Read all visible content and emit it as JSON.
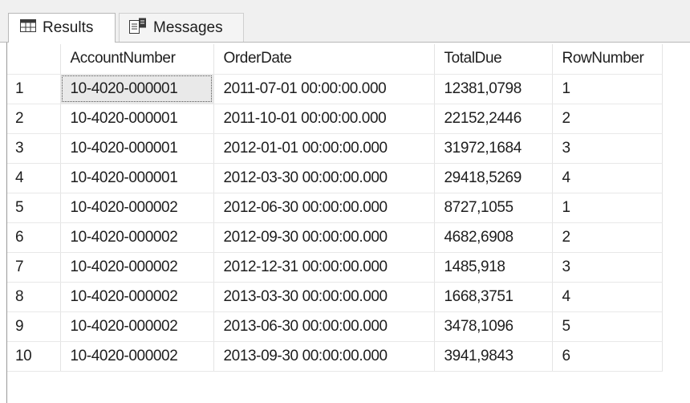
{
  "tabs": {
    "results_label": "Results",
    "messages_label": "Messages",
    "results_icon": "grid-icon",
    "messages_icon": "messages-icon"
  },
  "grid": {
    "columns": [
      "",
      "AccountNumber",
      "OrderDate",
      "TotalDue",
      "RowNumber"
    ],
    "rows": [
      [
        "1",
        "10-4020-000001",
        "2011-07-01 00:00:00.000",
        "12381,0798",
        "1"
      ],
      [
        "2",
        "10-4020-000001",
        "2011-10-01 00:00:00.000",
        "22152,2446",
        "2"
      ],
      [
        "3",
        "10-4020-000001",
        "2012-01-01 00:00:00.000",
        "31972,1684",
        "3"
      ],
      [
        "4",
        "10-4020-000001",
        "2012-03-30 00:00:00.000",
        "29418,5269",
        "4"
      ],
      [
        "5",
        "10-4020-000002",
        "2012-06-30 00:00:00.000",
        "8727,1055",
        "1"
      ],
      [
        "6",
        "10-4020-000002",
        "2012-09-30 00:00:00.000",
        "4682,6908",
        "2"
      ],
      [
        "7",
        "10-4020-000002",
        "2012-12-31 00:00:00.000",
        "1485,918",
        "3"
      ],
      [
        "8",
        "10-4020-000002",
        "2013-03-30 00:00:00.000",
        "1668,3751",
        "4"
      ],
      [
        "9",
        "10-4020-000002",
        "2013-06-30 00:00:00.000",
        "3478,1096",
        "5"
      ],
      [
        "10",
        "10-4020-000002",
        "2013-09-30 00:00:00.000",
        "3941,9843",
        "6"
      ]
    ]
  }
}
